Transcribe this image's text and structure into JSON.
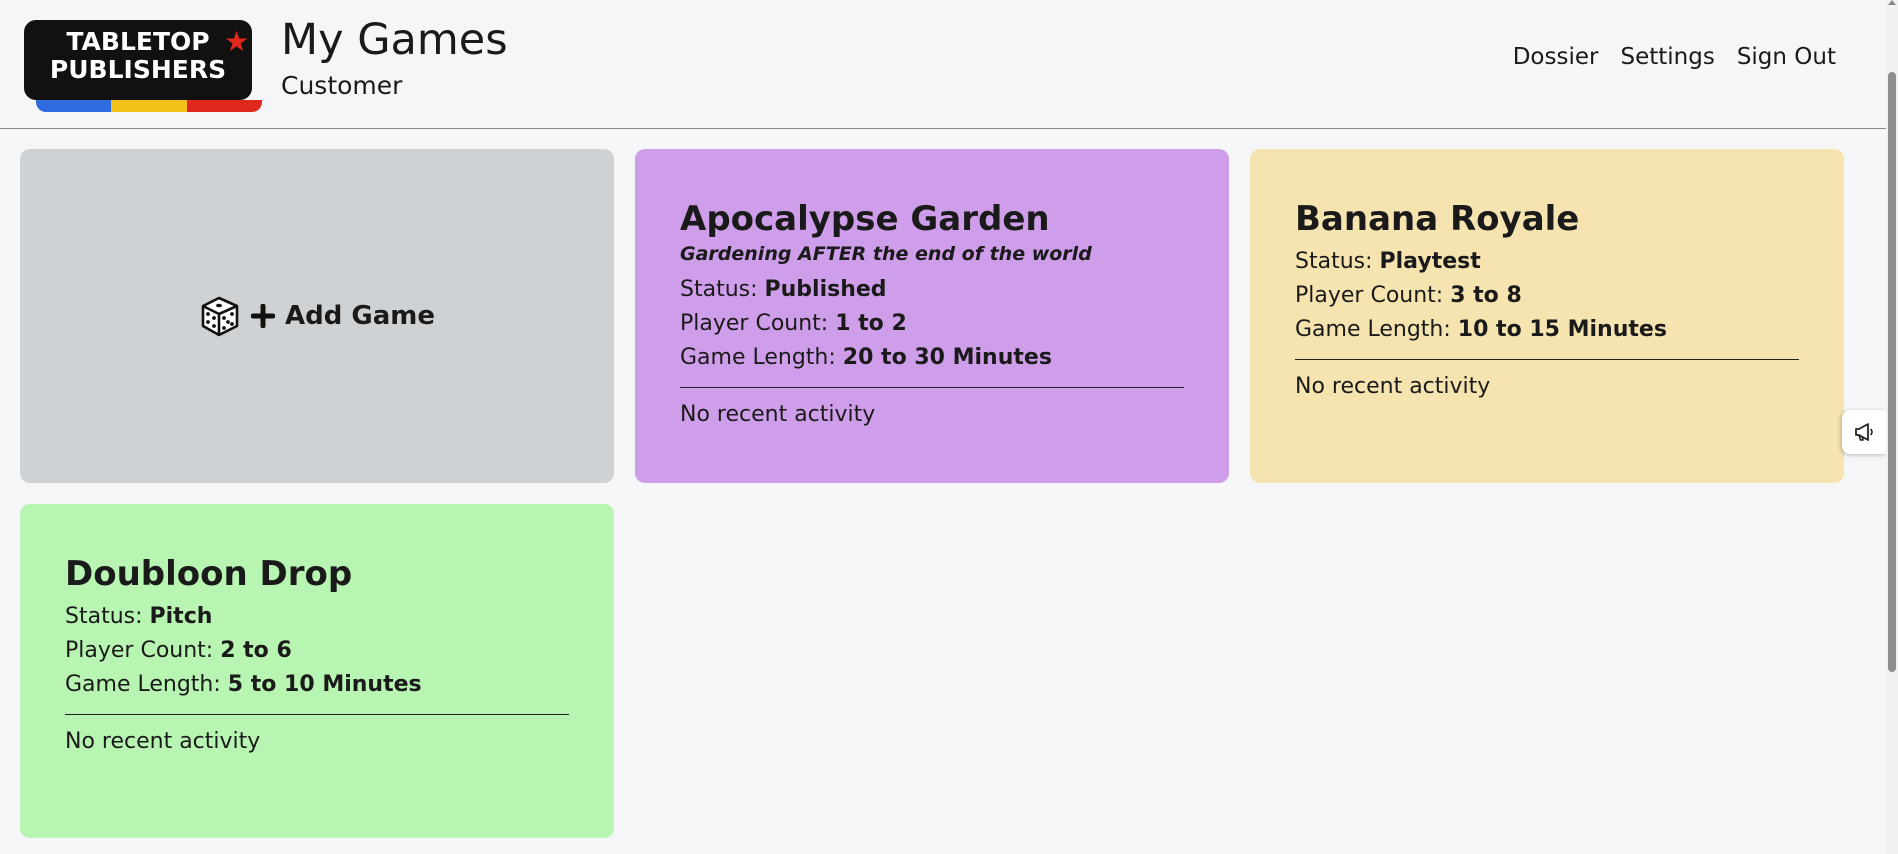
{
  "logo": {
    "line1": "TABLETOP",
    "line2": "PUBLISHERS",
    "stripe_colors": [
      "#2f6ce0",
      "#f2c21b",
      "#e0281e"
    ]
  },
  "header": {
    "title": "My Games",
    "subtitle": "Customer"
  },
  "nav": {
    "items": [
      {
        "label": "Dossier"
      },
      {
        "label": "Settings"
      },
      {
        "label": "Sign Out"
      }
    ]
  },
  "add_game": {
    "label": "Add Game",
    "icon": "dice-plus-icon"
  },
  "labels": {
    "status": "Status: ",
    "player_count": "Player Count: ",
    "game_length": "Game Length: "
  },
  "games": [
    {
      "title": "Apocalypse Garden",
      "tagline": "Gardening AFTER the end of the world",
      "status": "Published",
      "player_count": "1 to 2",
      "game_length": "20 to 30 Minutes",
      "activity": "No recent activity",
      "color": "#cf9eea"
    },
    {
      "title": "Banana Royale",
      "status": "Playtest",
      "player_count": "3 to 8",
      "game_length": "10 to 15 Minutes",
      "activity": "No recent activity",
      "color": "#f5e3b0"
    },
    {
      "title": "Doubloon Drop",
      "status": "Pitch",
      "player_count": "2 to 6",
      "game_length": "5 to 10 Minutes",
      "activity": "No recent activity",
      "color": "#b8f4b2"
    }
  ],
  "feedback": {
    "icon": "megaphone-icon"
  }
}
